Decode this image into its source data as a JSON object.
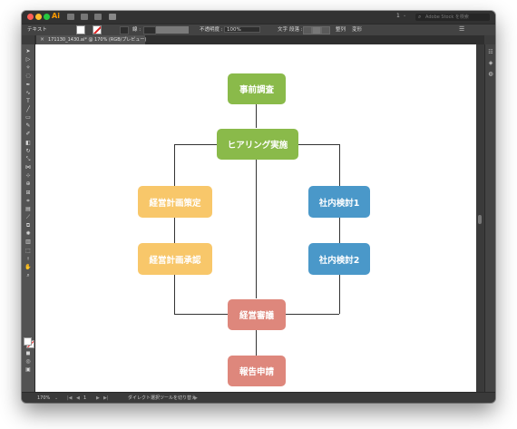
{
  "app": {
    "logo": "Ai",
    "page_number": "1",
    "search_placeholder": "Adobe Stock を検索"
  },
  "control_bar": {
    "selection_label": "テキスト",
    "stroke_label": "線 :",
    "opacity_label": "不透明度 :",
    "opacity_value": "100%",
    "character_label": "文字",
    "paragraph_label": "段落 :",
    "arrange_label": "整列",
    "transform_label": "変形"
  },
  "document_tab": {
    "close": "×",
    "title": "171130_1430.ai* @ 170% (RGB/プレビュー)"
  },
  "status_bar": {
    "zoom": "170%",
    "artboard": "1",
    "tool_hint": "ダイレクト選択ツールを切り替え"
  },
  "colors": {
    "green": "#8aba4a",
    "yellow": "#f8c76a",
    "blue": "#4a98c9",
    "red": "#de877c"
  },
  "flowchart": {
    "nodes": {
      "pre_survey": "事前調査",
      "hearing": "ヒアリング実施",
      "plan_draft": "経営計画策定",
      "plan_approval": "経営計画承認",
      "internal_review_1": "社内検討1",
      "internal_review_2": "社内検討2",
      "management_review": "経営審議",
      "report_apply": "報告申請"
    }
  }
}
